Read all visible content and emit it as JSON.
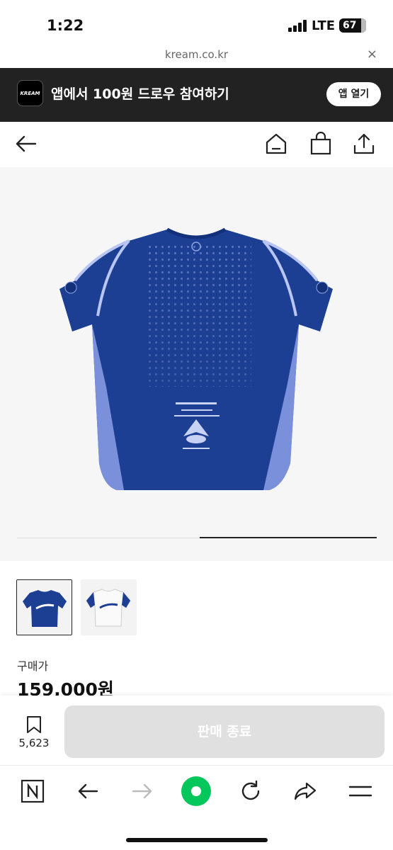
{
  "status": {
    "time": "1:22",
    "network": "LTE",
    "battery": "67"
  },
  "browser": {
    "url": "kream.co.kr",
    "close_glyph": "×"
  },
  "banner": {
    "logo": "KREAM",
    "text": "앱에서 100원 드로우 참여하기",
    "open_label": "앱 열기"
  },
  "navbar": {
    "icons": [
      "back-arrow-icon",
      "home-icon",
      "shopping-bag-icon",
      "share-icon"
    ]
  },
  "gallery": {
    "progress": 0.5,
    "thumbnail_count": 2,
    "selected_index": 0
  },
  "product": {
    "price_label": "구매가",
    "price": "159,000원"
  },
  "actionbar": {
    "bookmark_count": "5,623",
    "cta_label": "판매 종료"
  },
  "colors": {
    "accent": "#1c3f94",
    "banner_bg": "#222222",
    "cta_disabled": "#e0e0e0",
    "naver_green": "#03c75a"
  },
  "toolbar": {
    "icons": [
      "naver-n-icon",
      "back-icon",
      "forward-icon",
      "green-dot-icon",
      "reload-icon",
      "share-icon",
      "menu-icon"
    ]
  }
}
